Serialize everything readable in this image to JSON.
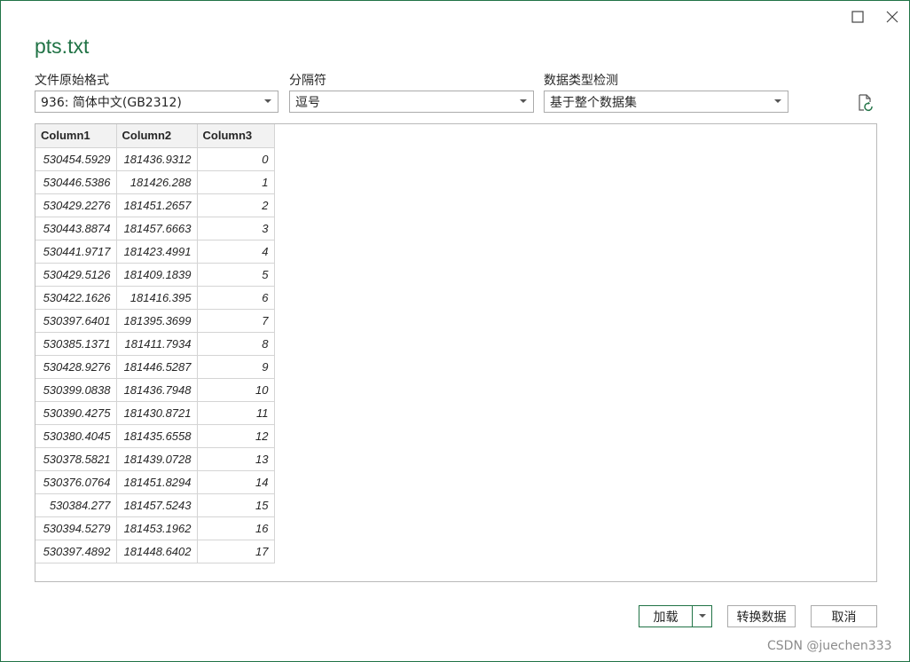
{
  "window": {
    "title": "pts.txt"
  },
  "options": {
    "file_origin": {
      "label": "文件原始格式",
      "value": "936: 简体中文(GB2312)"
    },
    "delimiter": {
      "label": "分隔符",
      "value": "逗号"
    },
    "data_type_detection": {
      "label": "数据类型检测",
      "value": "基于整个数据集"
    }
  },
  "preview": {
    "columns": [
      "Column1",
      "Column2",
      "Column3"
    ],
    "rows": [
      [
        "530454.5929",
        "181436.9312",
        "0"
      ],
      [
        "530446.5386",
        "181426.288",
        "1"
      ],
      [
        "530429.2276",
        "181451.2657",
        "2"
      ],
      [
        "530443.8874",
        "181457.6663",
        "3"
      ],
      [
        "530441.9717",
        "181423.4991",
        "4"
      ],
      [
        "530429.5126",
        "181409.1839",
        "5"
      ],
      [
        "530422.1626",
        "181416.395",
        "6"
      ],
      [
        "530397.6401",
        "181395.3699",
        "7"
      ],
      [
        "530385.1371",
        "181411.7934",
        "8"
      ],
      [
        "530428.9276",
        "181446.5287",
        "9"
      ],
      [
        "530399.0838",
        "181436.7948",
        "10"
      ],
      [
        "530390.4275",
        "181430.8721",
        "11"
      ],
      [
        "530380.4045",
        "181435.6558",
        "12"
      ],
      [
        "530378.5821",
        "181439.0728",
        "13"
      ],
      [
        "530376.0764",
        "181451.8294",
        "14"
      ],
      [
        "530384.277",
        "181457.5243",
        "15"
      ],
      [
        "530394.5279",
        "181453.1962",
        "16"
      ],
      [
        "530397.4892",
        "181448.6402",
        "17"
      ]
    ]
  },
  "buttons": {
    "load": "加载",
    "transform": "转换数据",
    "cancel": "取消"
  },
  "watermark": "CSDN @juechen333",
  "colors": {
    "accent": "#217346",
    "border": "#ababab"
  },
  "icons": {
    "maximize": "maximize-icon",
    "close": "close-icon",
    "refresh": "refresh-icon",
    "dropdown": "chevron-down-icon"
  }
}
